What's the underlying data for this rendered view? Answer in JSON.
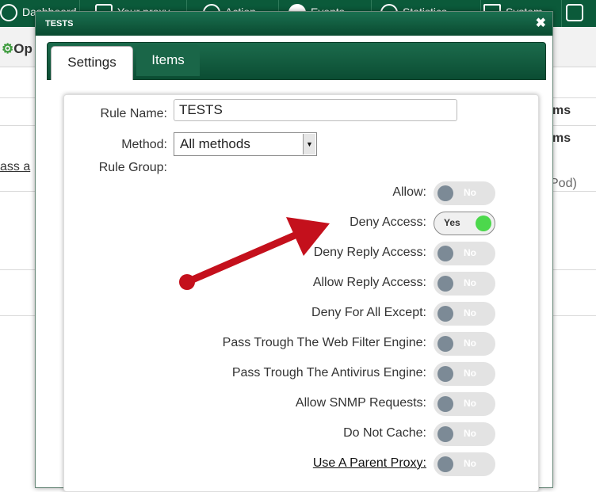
{
  "topnav": {
    "items": [
      {
        "label": "Dashboard",
        "icon": "dashboard-icon"
      },
      {
        "label": "Your proxy",
        "icon": "proxy-icon"
      },
      {
        "label": "Action",
        "icon": "action-icon"
      },
      {
        "label": "Events",
        "icon": "events-icon"
      },
      {
        "label": "Statistics",
        "icon": "statistics-icon"
      },
      {
        "label": "System",
        "icon": "system-icon"
      },
      {
        "label": "",
        "icon": "users-icon"
      }
    ]
  },
  "background": {
    "toolbar_fragment": "Op",
    "left_fragment": "ass a",
    "right_fragment_1": "ms",
    "right_fragment_2": "ms",
    "right_fragment_3": "Pod)"
  },
  "dialog": {
    "title": "TESTS",
    "close_glyph": "✖",
    "tabs": [
      {
        "label": "Settings",
        "active": true
      },
      {
        "label": "Items",
        "active": false
      }
    ]
  },
  "form": {
    "rule_name_label": "Rule Name:",
    "rule_name_value": "TESTS",
    "method_label": "Method:",
    "method_value": "All methods",
    "rule_group_label": "Rule Group:",
    "toggles": [
      {
        "label": "Allow:",
        "state": "No",
        "on": false
      },
      {
        "label": "Deny Access:",
        "state": "Yes",
        "on": true
      },
      {
        "label": "Deny Reply Access:",
        "state": "No",
        "on": false
      },
      {
        "label": "Allow Reply Access:",
        "state": "No",
        "on": false
      },
      {
        "label": "Deny For All Except:",
        "state": "No",
        "on": false
      },
      {
        "label": "Pass Trough The Web Filter Engine:",
        "state": "No",
        "on": false
      },
      {
        "label": "Pass Trough The Antivirus Engine:",
        "state": "No",
        "on": false
      },
      {
        "label": "Allow SNMP Requests:",
        "state": "No",
        "on": false
      },
      {
        "label": "Do Not Cache:",
        "state": "No",
        "on": false
      },
      {
        "label": "Use A Parent Proxy:",
        "state": "No",
        "on": false
      }
    ]
  },
  "colors": {
    "brand_green": "#0b5a3a",
    "toggle_on_knob": "#4cd84c",
    "annotation_arrow": "#c4101c"
  }
}
